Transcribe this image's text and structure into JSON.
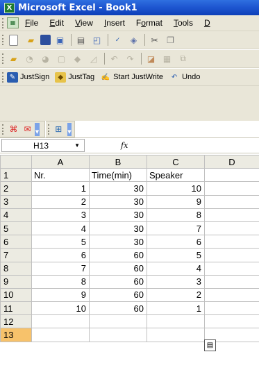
{
  "window": {
    "title": "Microsoft Excel - Book1",
    "app_icon_glyph": "X"
  },
  "menu": {
    "items": [
      {
        "pre": "",
        "u": "F",
        "post": "ile"
      },
      {
        "pre": "",
        "u": "E",
        "post": "dit"
      },
      {
        "pre": "",
        "u": "V",
        "post": "iew"
      },
      {
        "pre": "",
        "u": "I",
        "post": "nsert"
      },
      {
        "pre": "F",
        "u": "o",
        "post": "rmat"
      },
      {
        "pre": "",
        "u": "T",
        "post": "ools"
      },
      {
        "pre": "",
        "u": "D",
        "post": ""
      }
    ]
  },
  "toolbar_plugin": {
    "justsign": "JustSign",
    "justtag": "JustTag",
    "startjustwrite": "Start JustWrite",
    "undo": "Undo"
  },
  "formula": {
    "namebox": "H13",
    "fx": "fx",
    "content": ""
  },
  "sheet": {
    "columns": [
      "A",
      "B",
      "C",
      "D"
    ],
    "rows": [
      {
        "n": "1",
        "a": "Nr.",
        "b": "Time(min)",
        "c": "Speaker",
        "d": ""
      },
      {
        "n": "2",
        "a": "1",
        "b": "30",
        "c": "10",
        "d": ""
      },
      {
        "n": "3",
        "a": "2",
        "b": "30",
        "c": "9",
        "d": ""
      },
      {
        "n": "4",
        "a": "3",
        "b": "30",
        "c": "8",
        "d": ""
      },
      {
        "n": "5",
        "a": "4",
        "b": "30",
        "c": "7",
        "d": ""
      },
      {
        "n": "6",
        "a": "5",
        "b": "30",
        "c": "6",
        "d": ""
      },
      {
        "n": "7",
        "a": "6",
        "b": "60",
        "c": "5",
        "d": ""
      },
      {
        "n": "8",
        "a": "7",
        "b": "60",
        "c": "4",
        "d": ""
      },
      {
        "n": "9",
        "a": "8",
        "b": "60",
        "c": "3",
        "d": ""
      },
      {
        "n": "10",
        "a": "9",
        "b": "60",
        "c": "2",
        "d": ""
      },
      {
        "n": "11",
        "a": "10",
        "b": "60",
        "c": "1",
        "d": ""
      },
      {
        "n": "12",
        "a": "",
        "b": "",
        "c": "",
        "d": ""
      },
      {
        "n": "13",
        "a": "",
        "b": "",
        "c": "",
        "d": ""
      }
    ],
    "selected_row": "13"
  },
  "colors": {
    "title_blue": "#1f57d1",
    "toolbar_bg": "#e9e6d8",
    "header_bg": "#ecebe2",
    "selected_header": "#f7c26b",
    "grid_line": "#c0c0c0"
  }
}
